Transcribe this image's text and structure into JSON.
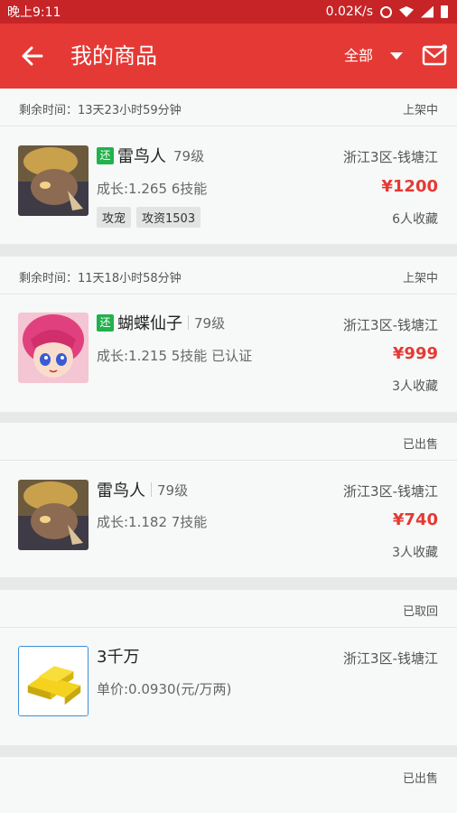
{
  "statusbar": {
    "time": "晚上9:11",
    "speed": "0.02K/s"
  },
  "header": {
    "title": "我的商品",
    "filter": "全部"
  },
  "items": [
    {
      "remaining": "剩余时间：13天23小时59分钟",
      "status": "上架中",
      "badge": "还",
      "name": "雷鸟人",
      "level": "79级",
      "region": "浙江3区-钱塘江",
      "detail": "成长:1.265 6技能",
      "price": "¥1200",
      "favorites": "6人收藏",
      "tags": [
        "攻宠",
        "攻资1503"
      ],
      "thumb_icon": "thunder-bird-pet-image"
    },
    {
      "remaining": "剩余时间：11天18小时58分钟",
      "status": "上架中",
      "badge": "还",
      "name": "蝴蝶仙子",
      "level": "79级",
      "region": "浙江3区-钱塘江",
      "detail": "成长:1.215 5技能 已认证",
      "price": "¥999",
      "favorites": "3人收藏",
      "thumb_icon": "butterfly-fairy-pet-image"
    },
    {
      "status": "已出售",
      "name": "雷鸟人",
      "level": "79级",
      "region": "浙江3区-钱塘江",
      "detail": "成长:1.182 7技能",
      "price": "¥740",
      "favorites": "3人收藏",
      "thumb_icon": "thunder-bird-pet-image"
    },
    {
      "status": "已取回",
      "name": "3千万",
      "region": "浙江3区-钱塘江",
      "detail": "单价:0.0930(元/万两)",
      "thumb_icon": "gold-bars-image"
    },
    {
      "status": "已出售"
    }
  ],
  "colors": {
    "brand_red": "#e53935",
    "status_bar": "#c62427",
    "badge_green": "#22b14c"
  }
}
